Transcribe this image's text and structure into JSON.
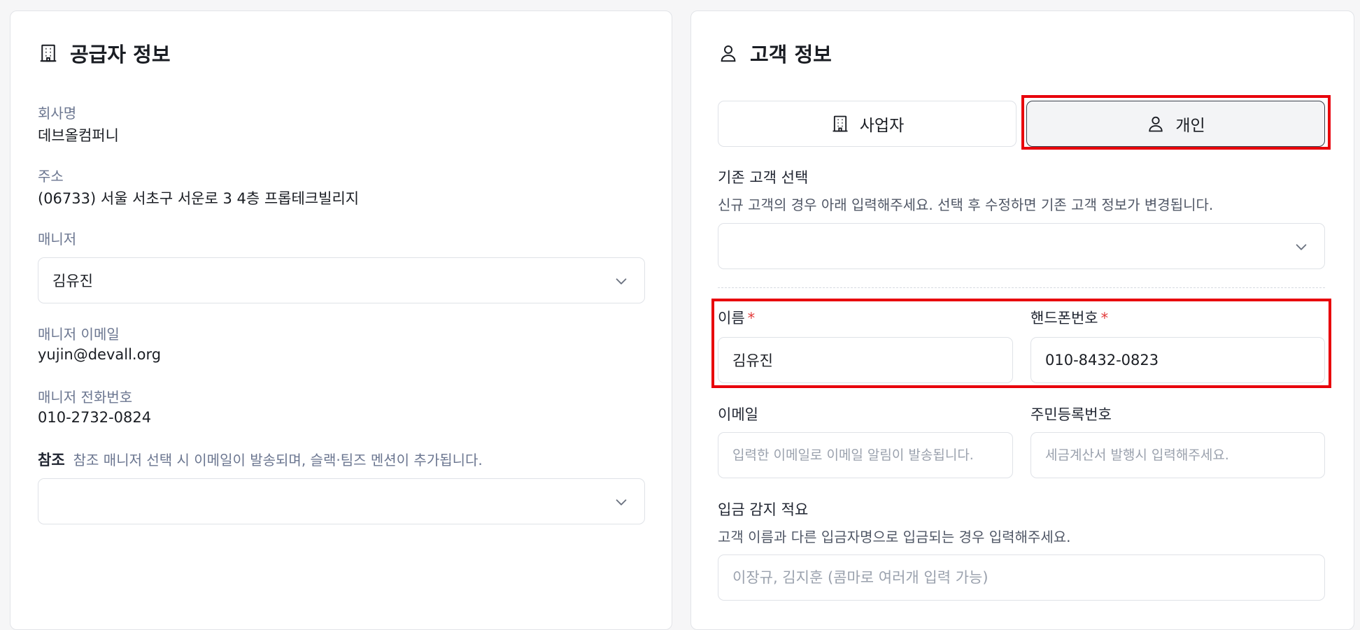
{
  "supplier": {
    "title": "공급자 정보",
    "title_icon": "building-icon",
    "company_label": "회사명",
    "company_value": "데브올컴퍼니",
    "address_label": "주소",
    "address_value": "(06733) 서울 서초구 서운로 3 4층 프롭테크빌리지",
    "manager_label": "매니저",
    "manager_value": "김유진",
    "manager_email_label": "매니저 이메일",
    "manager_email_value": "yujin@devall.org",
    "manager_phone_label": "매니저 전화번호",
    "manager_phone_value": "010-2732-0824",
    "reference_label": "참조",
    "reference_hint": "참조 매니저 선택 시 이메일이 발송되며, 슬랙·팀즈 멘션이 추가됩니다.",
    "reference_value": ""
  },
  "customer": {
    "title": "고객 정보",
    "title_icon": "user-icon",
    "type_options": [
      {
        "label": "사업자",
        "icon": "building-icon",
        "selected": false
      },
      {
        "label": "개인",
        "icon": "user-icon",
        "selected": true
      }
    ],
    "existing_label": "기존 고객 선택",
    "existing_hint": "신규 고객의 경우 아래 입력해주세요. 선택 후 수정하면 기존 고객 정보가 변경됩니다.",
    "existing_value": "",
    "name_label": "이름",
    "name_value": "김유진",
    "phone_label": "핸드폰번호",
    "phone_value": "010-8432-0823",
    "required_mark": "*",
    "email_label": "이메일",
    "email_placeholder": "입력한 이메일로 이메일 알림이 발송됩니다.",
    "rrn_label": "주민등록번호",
    "rrn_placeholder": "세금계산서 발행시 입력해주세요.",
    "deposit_label": "입금 감지 적요",
    "deposit_hint": "고객 이름과 다른 입금자명으로 입금되는 경우 입력해주세요.",
    "deposit_placeholder": "이장규, 김지훈 (콤마로 여러개 입력 가능)"
  },
  "colors": {
    "highlight": "#e8000b",
    "required": "#e23b3b",
    "muted_label": "#6b7690"
  }
}
